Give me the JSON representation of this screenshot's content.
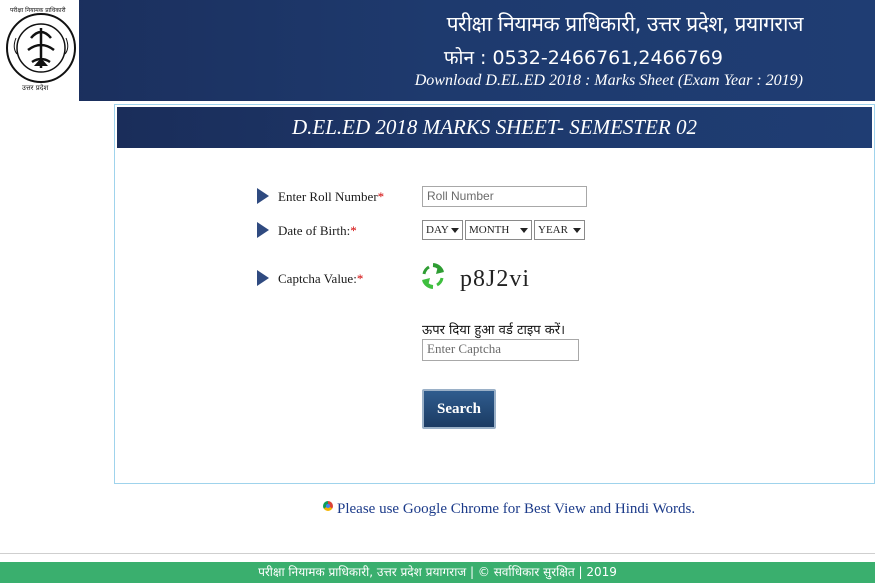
{
  "header": {
    "org_name": "परीक्षा नियामक प्राधिकारी, उत्तर प्रदेश, प्रयागराज",
    "phone": "फोन : 0532-2466761,2466769",
    "subtitle": "Download D.EL.ED 2018 : Marks Sheet (Exam Year : 2019)",
    "logo_top_text": "परीक्षा नियामक प्राधिकारी",
    "logo_bottom_text": "उत्तर प्रदेश"
  },
  "panel": {
    "title": "D.EL.ED 2018 MARKS SHEET- SEMESTER 02"
  },
  "form": {
    "roll_label": "Enter Roll Number",
    "roll_placeholder": "Roll Number",
    "dob_label": "Date of Birth:",
    "day_value": "DAY",
    "month_value": "MONTH",
    "year_value": "YEAR",
    "captcha_label": "Captcha Value:",
    "required_mark": "*",
    "captcha_code": "p8J2vi",
    "captcha_hint": "ऊपर दिया हुआ वर्ड टाइप करें।",
    "captcha_placeholder": "Enter Captcha",
    "search_label": "Search"
  },
  "note": "Please use Google Chrome for Best View and Hindi Words.",
  "footer": "परीक्षा नियामक प्राधिकारी, उत्तर प्रदेश प्रयागराज | © सर्वाधिकार सुरक्षित | 2019",
  "colors": {
    "header_bg": "#1e3a6e",
    "footer_bg": "#3aaf6e",
    "required": "#d10000",
    "link_text": "#1c3b8a"
  },
  "icons": [
    "emblem-logo",
    "arrow-right-icon",
    "refresh-icon",
    "chrome-icon"
  ]
}
